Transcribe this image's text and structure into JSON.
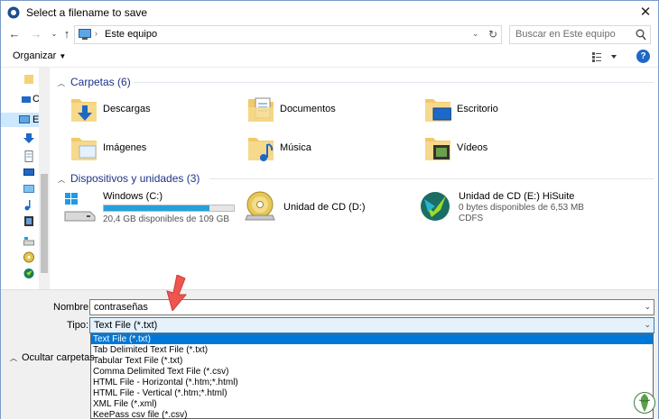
{
  "window": {
    "title": "Select a filename to save"
  },
  "address_bar": {
    "path": "Este equipo",
    "search_placeholder": "Buscar en Este equipo"
  },
  "toolbar": {
    "organize_label": "Organizar"
  },
  "sidebar": {
    "partial_labels": [
      "C",
      "E"
    ]
  },
  "folders_group": {
    "heading": "Carpetas (6)",
    "items": [
      {
        "label": "Descargas",
        "icon": "downloads-folder-icon"
      },
      {
        "label": "Documentos",
        "icon": "documents-folder-icon"
      },
      {
        "label": "Escritorio",
        "icon": "desktop-folder-icon"
      },
      {
        "label": "Imágenes",
        "icon": "pictures-folder-icon"
      },
      {
        "label": "Música",
        "icon": "music-folder-icon"
      },
      {
        "label": "Vídeos",
        "icon": "videos-folder-icon"
      }
    ]
  },
  "devices_group": {
    "heading": "Dispositivos y unidades (3)",
    "drives": [
      {
        "name": "Windows (C:)",
        "space": "20,4 GB disponibles de 109 GB",
        "used_fraction": 0.81
      },
      {
        "name": "Unidad de CD (D:)"
      },
      {
        "name": "Unidad de CD (E:) HiSuite",
        "space": "0 bytes disponibles de 6,53 MB",
        "filesystem": "CDFS"
      }
    ]
  },
  "save_panel": {
    "name_label": "Nombre:",
    "name_value": "contraseñas",
    "type_label": "Tipo:",
    "type_value": "Text File (*.txt)",
    "type_options": [
      "Text File (*.txt)",
      "Tab Delimited Text File (*.txt)",
      "Tabular Text File (*.txt)",
      "Comma Delimited Text File (*.csv)",
      "HTML File - Horizontal (*.htm;*.html)",
      "HTML File - Vertical (*.htm;*.html)",
      "XML File (*.xml)",
      "KeePass csv file (*.csv)"
    ],
    "hide_folders_label": "Ocultar carpetas"
  },
  "colors": {
    "accent": "#0078d7",
    "header_text": "#1e3287",
    "drive_bar": "#26a0da",
    "annotation_arrow": "#f0544f"
  }
}
